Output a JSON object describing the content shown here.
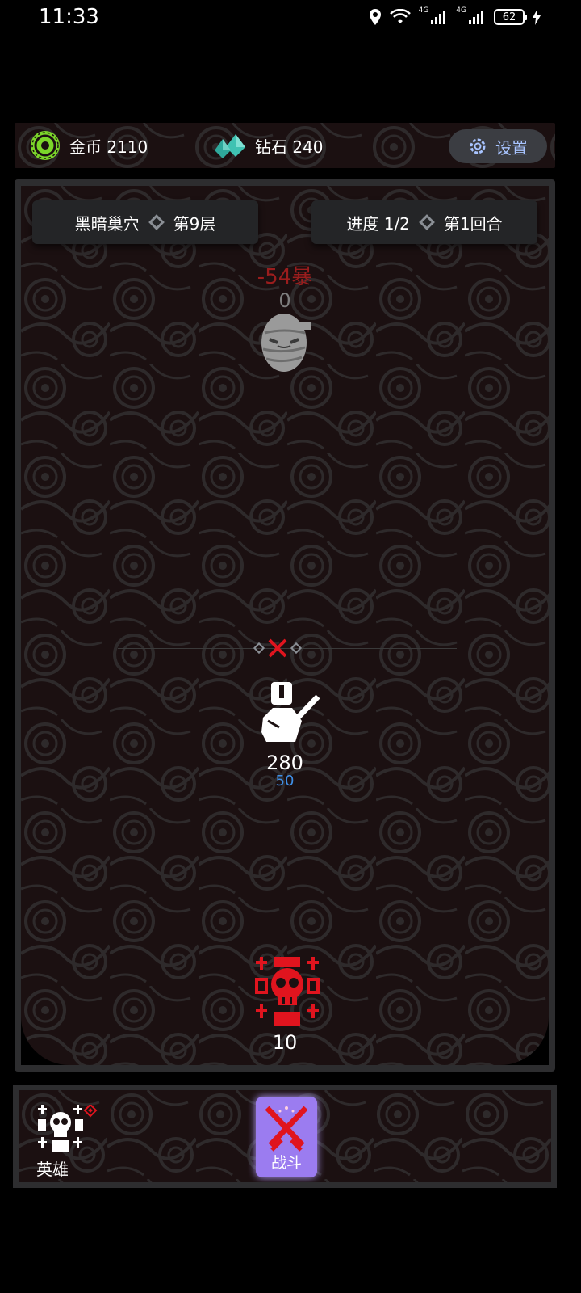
{
  "status_bar": {
    "time": "11:33",
    "network_1": "4G",
    "network_2": "4G",
    "battery": "62",
    "icons": [
      "location-icon",
      "wifi-icon",
      "signal-icon",
      "signal-icon",
      "battery-icon",
      "charging-icon"
    ]
  },
  "resources": {
    "gold_label": "金币 2110",
    "gem_label": "钻石 240",
    "settings_label": "设置"
  },
  "stage": {
    "location": "黑暗巢穴",
    "floor": "第9层",
    "progress": "进度 1/2",
    "round": "第1回合"
  },
  "enemy": {
    "damage_text": "-54暴",
    "hp": "0"
  },
  "hero": {
    "hp": "280",
    "shield": "50"
  },
  "boss": {
    "hp": "10"
  },
  "bottom": {
    "hero_label": "英雄",
    "battle_label": "战斗"
  },
  "colors": {
    "accent_purple": "#9b7cf0",
    "damage_red": "#9a1d1d",
    "shield_blue": "#3f8fe6",
    "boss_red": "#e0141e",
    "settings_text": "#a8c4ff"
  }
}
